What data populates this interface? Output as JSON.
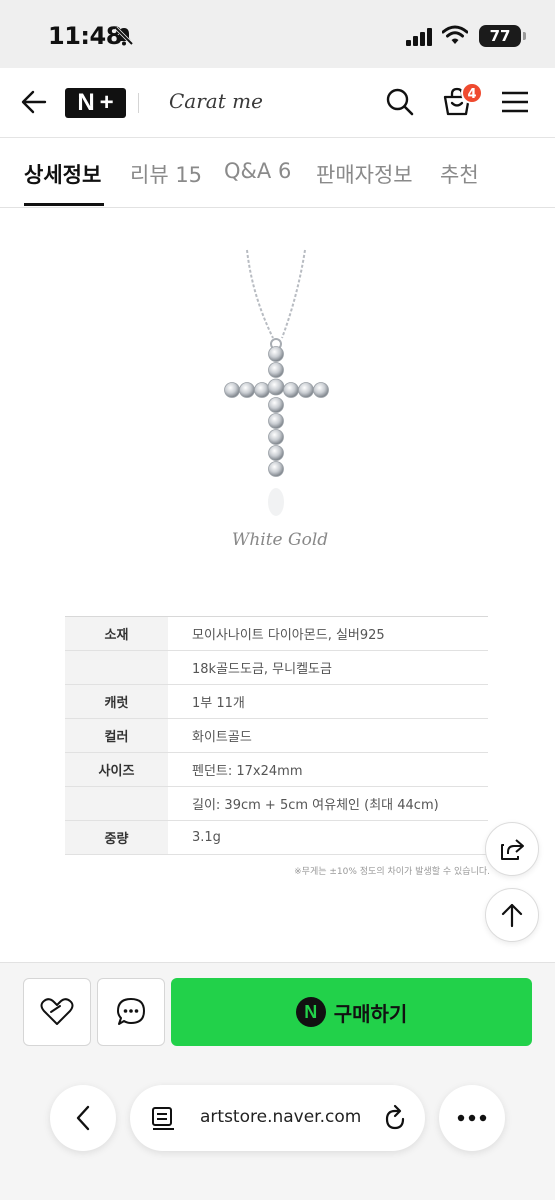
{
  "status_bar": {
    "time": "11:48",
    "battery": "77"
  },
  "header": {
    "store_name": "Carat me",
    "cart_count": "4",
    "logo_letters": [
      "N",
      "+"
    ]
  },
  "tabs": [
    {
      "label": "상세정보",
      "active": true
    },
    {
      "label": "리뷰 15",
      "active": false
    },
    {
      "label": "Q&A 6",
      "active": false
    },
    {
      "label": "판매자정보",
      "active": false
    },
    {
      "label": "추천",
      "active": false
    }
  ],
  "product_image": {
    "caption": "White Gold"
  },
  "spec_table": [
    {
      "label": "소재",
      "value": "모이사나이트 다이아몬드, 실버925"
    },
    {
      "label": "",
      "value": "18k골드도금, 무니켈도금"
    },
    {
      "label": "캐럿",
      "value": "1부 11개"
    },
    {
      "label": "컬러",
      "value": "화이트골드"
    },
    {
      "label": "사이즈",
      "value": "펜던트: 17x24mm"
    },
    {
      "label": "",
      "value": "길이: 39cm + 5cm 여유체인 (최대 44cm)"
    },
    {
      "label": "중량",
      "value": "3.1g"
    }
  ],
  "spec_note": "※무게는 ±10% 정도의 차이가 발생할 수 있습니다.",
  "purchase": {
    "button_label": "구매하기",
    "badge_letter": "N"
  },
  "browser": {
    "url": "artstore.naver.com"
  },
  "colors": {
    "buy_green": "#22d14a",
    "badge_red": "#ef4a2f"
  },
  "icons": [
    "back-arrow-icon",
    "search-icon",
    "cart-icon",
    "menu-icon",
    "heart-icon",
    "chat-icon",
    "share-icon",
    "arrow-up-icon",
    "reader-icon",
    "reload-icon",
    "more-icon"
  ]
}
